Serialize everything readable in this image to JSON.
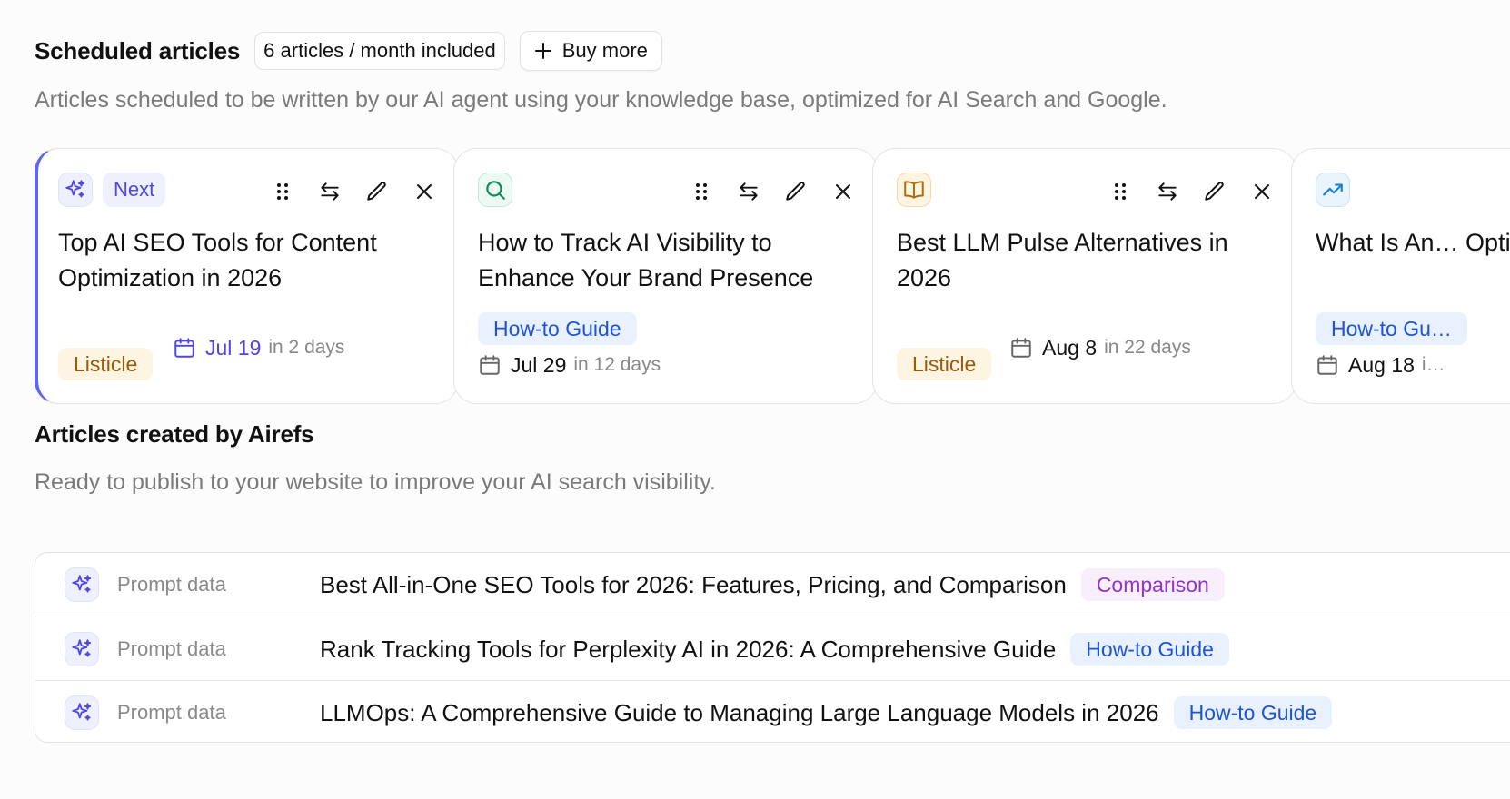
{
  "scheduled": {
    "title": "Scheduled articles",
    "included_badge": "6 articles / month included",
    "buy_more_label": "Buy more",
    "subtitle": "Articles scheduled to be written by our AI agent using your knowledge base, optimized for AI Search and Google.",
    "next_label": "Next",
    "cards": [
      {
        "icon": "sparkles-icon",
        "title": "Top AI SEO Tools for Content Optimization in 2026",
        "tag": "Listicle",
        "date": "Jul 19",
        "relative": "in 2 days"
      },
      {
        "icon": "search-icon",
        "title": "How to Track AI Visibility to Enhance Your Brand Presence",
        "tag": "How-to Guide",
        "date": "Jul 29",
        "relative": "in 12 days"
      },
      {
        "icon": "book-open-icon",
        "title": "Best LLM Pulse Alternatives in 2026",
        "tag": "Listicle",
        "date": "Aug 8",
        "relative": "in 22 days"
      },
      {
        "icon": "trending-up-icon",
        "title": "What Is An… Optimizati…",
        "tag": "How-to Gu…",
        "date": "Aug 18",
        "relative": "i…"
      }
    ]
  },
  "created": {
    "title": "Articles created by Airefs",
    "subtitle": "Ready to publish to your website to improve your AI search visibility.",
    "rows": [
      {
        "source": "Prompt data",
        "title": "Best All-in-One SEO Tools for 2026: Features, Pricing, and Comparison",
        "tag": "Comparison"
      },
      {
        "source": "Prompt data",
        "title": "Rank Tracking Tools for Perplexity AI in 2026: A Comprehensive Guide",
        "tag": "How-to Guide"
      },
      {
        "source": "Prompt data",
        "title": "LLMOps: A Comprehensive Guide to Managing Large Language Models in 2026",
        "tag": "How-to Guide"
      }
    ]
  },
  "colors": {
    "accent": "#4f46e5",
    "howto_bg": "#eaf1fe",
    "howto_text": "#1d54d6",
    "listicle_bg": "#fdf4e2",
    "listicle_text": "#9a5a09",
    "comparison_bg": "#f9effc",
    "comparison_text": "#9333c9"
  }
}
